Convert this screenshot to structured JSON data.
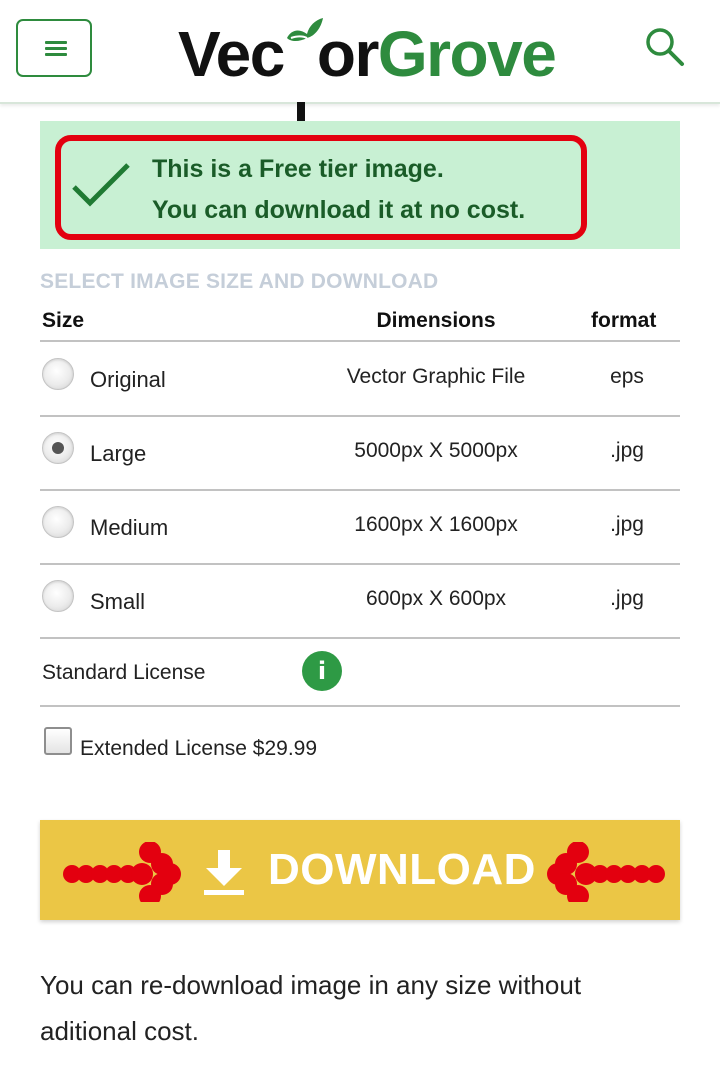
{
  "header": {
    "logo_part1": "Vec",
    "logo_part2": "or",
    "logo_part3": "Grove",
    "menu_icon": "hamburger-icon",
    "search_icon": "search-icon"
  },
  "free_banner": {
    "line1": "This is a Free tier image.",
    "line2": "You can download it at no cost.",
    "icon": "checkmark-icon"
  },
  "size_section": {
    "title": "SELECT IMAGE SIZE AND DOWNLOAD",
    "columns": [
      "Size",
      "Dimensions",
      "format"
    ],
    "rows": [
      {
        "label": "Original",
        "dimensions": "Vector Graphic File",
        "format": "eps",
        "selected": false
      },
      {
        "label": "Large",
        "dimensions": "5000px X 5000px",
        "format": ".jpg",
        "selected": true
      },
      {
        "label": "Medium",
        "dimensions": "1600px X 1600px",
        "format": ".jpg",
        "selected": false
      },
      {
        "label": "Small",
        "dimensions": "600px X 600px",
        "format": ".jpg",
        "selected": false
      }
    ],
    "standard_license": "Standard License",
    "info_icon": "i",
    "extended_license": "Extended License $29.99",
    "extended_checked": false
  },
  "download": {
    "label": "DOWNLOAD",
    "icon": "download-icon"
  },
  "note": "You can re-download image in any size without aditional cost.",
  "colors": {
    "brand_green": "#2e8b3e",
    "banner_bg": "#c8f0d3",
    "highlight_red": "#e3000f",
    "download_bg": "#ebc645"
  }
}
